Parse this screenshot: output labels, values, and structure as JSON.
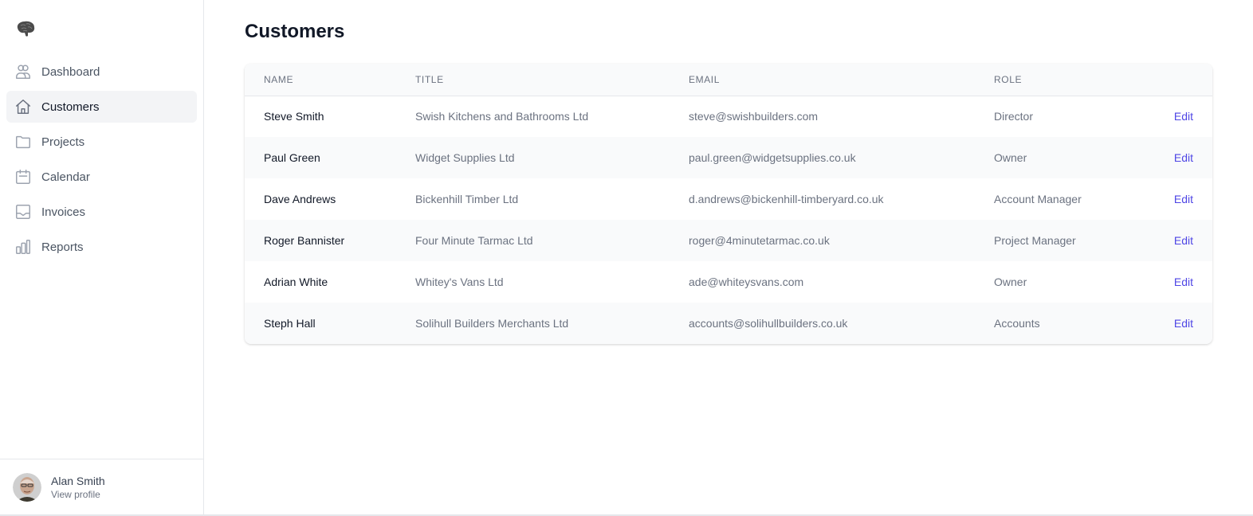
{
  "sidebar": {
    "logo": "brain-logo",
    "items": [
      {
        "label": "Dashboard",
        "icon": "users-icon",
        "active": false
      },
      {
        "label": "Customers",
        "icon": "home-icon",
        "active": true
      },
      {
        "label": "Projects",
        "icon": "folder-icon",
        "active": false
      },
      {
        "label": "Calendar",
        "icon": "calendar-icon",
        "active": false
      },
      {
        "label": "Invoices",
        "icon": "inbox-icon",
        "active": false
      },
      {
        "label": "Reports",
        "icon": "chart-bar-icon",
        "active": false
      }
    ],
    "profile": {
      "name": "Alan Smith",
      "link_label": "View profile"
    }
  },
  "main": {
    "title": "Customers",
    "table": {
      "columns": [
        "NAME",
        "TITLE",
        "EMAIL",
        "ROLE",
        ""
      ],
      "rows": [
        {
          "name": "Steve Smith",
          "title": "Swish Kitchens and Bathrooms Ltd",
          "email": "steve@swishbuilders.com",
          "role": "Director",
          "action": "Edit"
        },
        {
          "name": "Paul Green",
          "title": "Widget Supplies Ltd",
          "email": "paul.green@widgetsupplies.co.uk",
          "role": "Owner",
          "action": "Edit"
        },
        {
          "name": "Dave Andrews",
          "title": "Bickenhill Timber Ltd",
          "email": "d.andrews@bickenhill-timberyard.co.uk",
          "role": "Account Manager",
          "action": "Edit"
        },
        {
          "name": "Roger Bannister",
          "title": "Four Minute Tarmac Ltd",
          "email": "roger@4minutetarmac.co.uk",
          "role": "Project Manager",
          "action": "Edit"
        },
        {
          "name": "Adrian White",
          "title": "Whitey's Vans Ltd",
          "email": "ade@whiteysvans.com",
          "role": "Owner",
          "action": "Edit"
        },
        {
          "name": "Steph Hall",
          "title": "Solihull Builders Merchants Ltd",
          "email": "accounts@solihullbuilders.co.uk",
          "role": "Accounts",
          "action": "Edit"
        }
      ]
    }
  },
  "colors": {
    "accent": "#4f46e5",
    "active_nav_bg": "#f3f4f6",
    "row_alt_bg": "#f9fafb"
  }
}
